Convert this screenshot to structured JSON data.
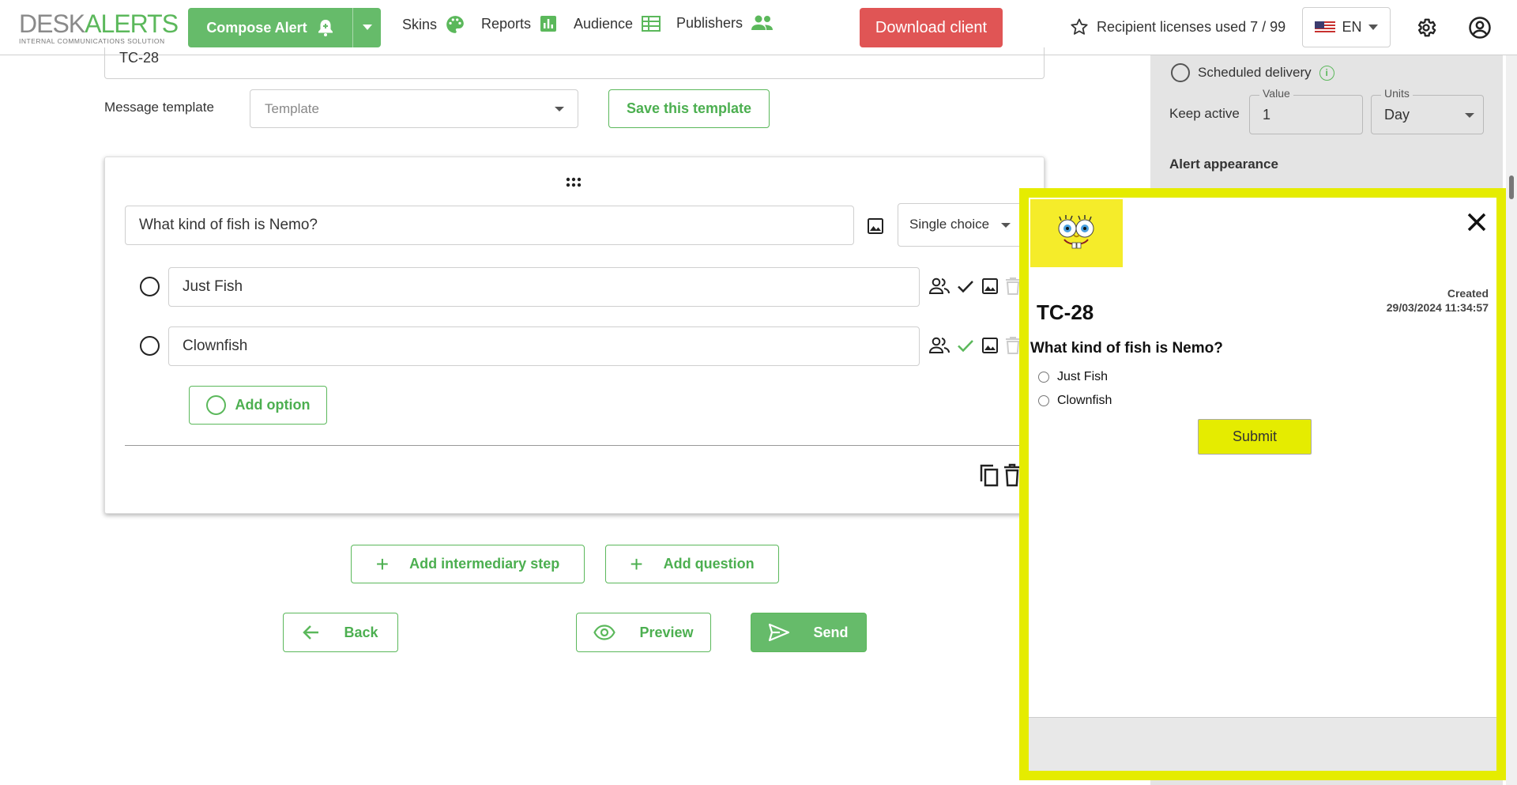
{
  "header": {
    "logo_part1": "DESK",
    "logo_part2": "ALERTS",
    "logo_sub": "INTERNAL COMMUNICATIONS SOLUTION",
    "compose_label": "Compose Alert",
    "nav": [
      {
        "label": "Skins",
        "icon": "palette-icon"
      },
      {
        "label": "Reports",
        "icon": "bar-chart-icon"
      },
      {
        "label": "Audience",
        "icon": "audience-table-icon"
      },
      {
        "label": "Publishers",
        "icon": "people-icon"
      }
    ],
    "download_label": "Download client",
    "licenses_label": "Recipient licenses used 7 / 99",
    "language": "EN"
  },
  "colors": {
    "accent": "#5bb85b",
    "danger": "#e05555",
    "popup_border": "#e5ec00"
  },
  "side_panel": {
    "scheduled_label": "Scheduled delivery",
    "keep_active_label": "Keep active",
    "value_legend": "Value",
    "value": "1",
    "units_legend": "Units",
    "units": "Day",
    "appearance_label": "Alert appearance"
  },
  "form": {
    "subject_value": "TC-28",
    "template_label": "Message template",
    "template_placeholder": "Template",
    "save_template_label": "Save this template"
  },
  "question": {
    "text": "What kind of fish is Nemo?",
    "type": "Single choice",
    "options": [
      "Just Fish",
      "Clownfish"
    ],
    "add_option_label": "Add option"
  },
  "actions": {
    "add_step_label": "Add intermediary step",
    "add_question_label": "Add question",
    "back_label": "Back",
    "preview_label": "Preview",
    "send_label": "Send"
  },
  "preview_popup": {
    "title": "TC-28",
    "created_label": "Created",
    "created_date": "29/03/2024 11:34:57",
    "question": "What kind of fish is Nemo?",
    "options": [
      "Just Fish",
      "Clownfish"
    ],
    "submit_label": "Submit"
  }
}
